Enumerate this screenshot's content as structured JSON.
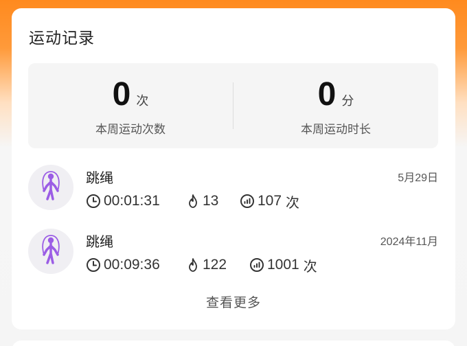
{
  "section_title": "运动记录",
  "summary": {
    "weekly_count": {
      "value": "0",
      "unit": "次",
      "label": "本周运动次数"
    },
    "weekly_duration": {
      "value": "0",
      "unit": "分",
      "label": "本周运动时长"
    }
  },
  "records": [
    {
      "name": "跳绳",
      "date": "5月29日",
      "duration": "00:01:31",
      "calories": "13",
      "count": "107",
      "count_unit": "次",
      "icon": "jump-rope-icon"
    },
    {
      "name": "跳绳",
      "date": "2024年11月",
      "duration": "00:09:36",
      "calories": "122",
      "count": "1001",
      "count_unit": "次",
      "icon": "jump-rope-icon"
    }
  ],
  "view_more_label": "查看更多",
  "colors": {
    "accent_orange": "#ff8a1e",
    "icon_purple": "#9b5de5"
  }
}
